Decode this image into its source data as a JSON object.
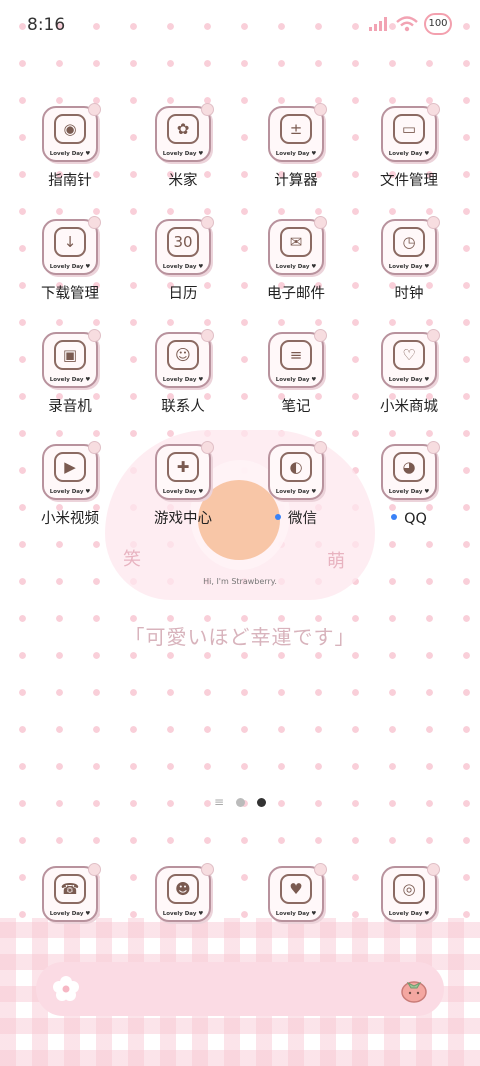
{
  "status": {
    "time": "8:16",
    "battery": "100"
  },
  "apps": [
    {
      "label": "指南针",
      "glyph": "◉",
      "tag": "Lovely Day ♥"
    },
    {
      "label": "米家",
      "glyph": "✿",
      "tag": "Lovely Day ♥"
    },
    {
      "label": "计算器",
      "glyph": "±",
      "tag": "Lovely Day ♥"
    },
    {
      "label": "文件管理",
      "glyph": "▭",
      "tag": "Lovely Day ♥"
    },
    {
      "label": "下载管理",
      "glyph": "↓",
      "tag": "Lovely Day ♥"
    },
    {
      "label": "日历",
      "glyph": "30",
      "tag": "Lovely Day ♥"
    },
    {
      "label": "电子邮件",
      "glyph": "✉",
      "tag": "Lovely Day ♥"
    },
    {
      "label": "时钟",
      "glyph": "◷",
      "tag": "Lovely Day ♥"
    },
    {
      "label": "录音机",
      "glyph": "▣",
      "tag": "Lovely Day ♥"
    },
    {
      "label": "联系人",
      "glyph": "☺",
      "tag": "Lovely Day ♥"
    },
    {
      "label": "笔记",
      "glyph": "≡",
      "tag": "Lovely Day ♥"
    },
    {
      "label": "小米商城",
      "glyph": "♡",
      "tag": "Lovely Day ♥"
    },
    {
      "label": "小米视频",
      "glyph": "▶",
      "tag": "Lovely Day ♥"
    },
    {
      "label": "游戏中心",
      "glyph": "✚",
      "tag": "Lovely Day ♥"
    },
    {
      "label": "微信",
      "glyph": "◐",
      "tag": "Lovely Day ♥",
      "notify": true
    },
    {
      "label": "QQ",
      "glyph": "◕",
      "tag": "Lovely Day ♥",
      "notify": true
    }
  ],
  "dock": [
    {
      "icon": "phone-icon",
      "glyph": "☎",
      "tag": "Lovely Day ♥"
    },
    {
      "icon": "messages-icon",
      "glyph": "☻",
      "tag": "Lovely Day ♥"
    },
    {
      "icon": "heart-chat-icon",
      "glyph": "♥",
      "tag": "Lovely Day ♥"
    },
    {
      "icon": "camera-icon",
      "glyph": "◎",
      "tag": "Lovely Day ♥"
    }
  ],
  "wallpaper": {
    "caption": "Hi, I'm Strawberry.",
    "slogan": "「可愛いほど幸運です」",
    "left_badge": "笑",
    "right_badge": "萌"
  },
  "pager": {
    "lines": "≡"
  },
  "colors": {
    "dot_pink": "#f9cfd9",
    "icon_border": "#b8929d",
    "search_bar": "#fbdbe4",
    "notify_blue": "#3a82f7"
  }
}
